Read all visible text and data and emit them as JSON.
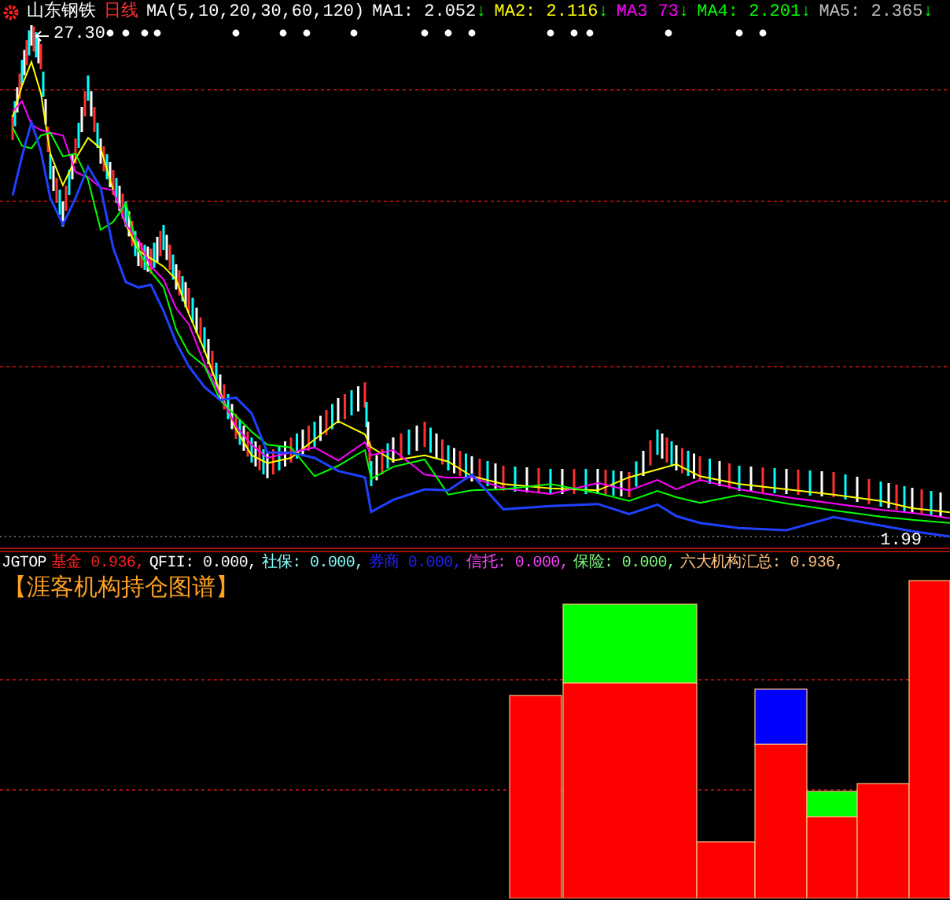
{
  "header": {
    "stock": "山东钢铁",
    "period": "日线",
    "ma_params": "MA(5,10,20,30,60,120)",
    "ma_lines": [
      {
        "label": "MA1:",
        "value": "2.052",
        "arrow": "↓",
        "color": "#ffffff"
      },
      {
        "label": "MA2:",
        "value": "2.116",
        "arrow": "↓",
        "color": "#ffff00"
      },
      {
        "label": "MA3",
        "value": "73",
        "arrow": "↓",
        "color": "#ff00ff"
      },
      {
        "label": "MA4:",
        "value": "2.201",
        "arrow": "↓",
        "color": "#00ff00"
      },
      {
        "label": "MA5:",
        "value": "2.365",
        "arrow": "↓",
        "color": "#c0c0c0"
      }
    ]
  },
  "price_chart": {
    "high_label": "27.30",
    "low_label": "1.99"
  },
  "indicator": {
    "name": "JGTOP",
    "items": [
      {
        "label": "基金",
        "value": "0.936,",
        "color": "#ff2020"
      },
      {
        "label": "QFII:",
        "value": "0.000,",
        "color": "#ffffff"
      },
      {
        "label": "社保:",
        "value": "0.000,",
        "color": "#80ffff"
      },
      {
        "label": "券商",
        "value": "0.000,",
        "color": "#2020ff"
      },
      {
        "label": "信托:",
        "value": "0.000,",
        "color": "#ff40ff"
      },
      {
        "label": "保险:",
        "value": "0.000,",
        "color": "#80ff80"
      },
      {
        "label": "六大机构汇总:",
        "value": "0.936,",
        "color": "#ffc080"
      }
    ],
    "title": "【涯客机构持仓图谱】"
  }
}
